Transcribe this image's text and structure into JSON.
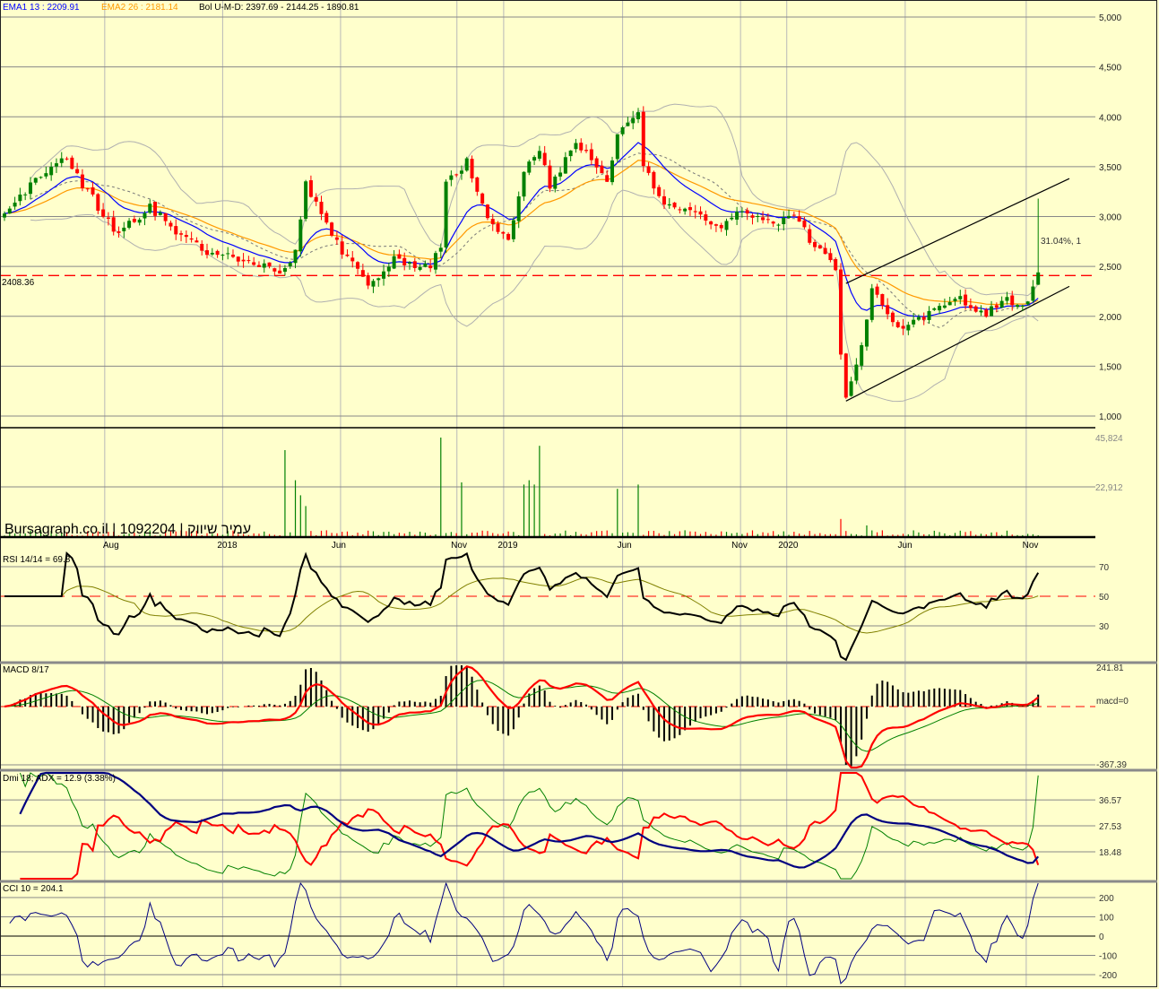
{
  "header": {
    "ema1_label": "EMA1 13 : 2209.91",
    "ema2_label": "EMA2 26 : 2181.14",
    "bollinger_label": "Bol U-M-D: 2397.69 - 2144.25 - 1890.81",
    "ref_line_label": "2408.36",
    "annotation": "31.04%, 1",
    "watermark": "Bursagraph.co.il | 1092204 | עמיר שיווק"
  },
  "panels": {
    "rsi_label": "RSI 14/14 = 69.8",
    "macd_label": "MACD 8/17",
    "macd_zero_label": "macd=0",
    "dmi_label": "Dmi 18; ADX = 12.9 (3.38%)",
    "cci_label": "CCI 10 = 204.1"
  },
  "colors": {
    "background": "#FFFFCC",
    "up": "#008000",
    "down": "#FF0000",
    "ema1": "#0000FF",
    "ema2": "#FF9900",
    "bollinger": "#B0B0B0",
    "grid": "#888888",
    "vgrid": "#B8B8B8"
  },
  "chart_data": {
    "type": "candlestick",
    "candles": 200,
    "price_path": [
      [
        0,
        2987
      ],
      [
        6,
        3373
      ],
      [
        11,
        3625
      ],
      [
        15,
        3328
      ],
      [
        21,
        2879
      ],
      [
        23,
        2879
      ],
      [
        28,
        3100
      ],
      [
        34,
        2789
      ],
      [
        41,
        2609
      ],
      [
        47,
        2564
      ],
      [
        54,
        2450
      ],
      [
        56,
        2700
      ],
      [
        58,
        3328
      ],
      [
        61,
        3013
      ],
      [
        65,
        2654
      ],
      [
        70,
        2294
      ],
      [
        75,
        2564
      ],
      [
        82,
        2500
      ],
      [
        84,
        2700
      ],
      [
        85,
        3328
      ],
      [
        89,
        3553
      ],
      [
        93,
        2969
      ],
      [
        97,
        2744
      ],
      [
        100,
        3418
      ],
      [
        103,
        3688
      ],
      [
        105,
        3283
      ],
      [
        110,
        3733
      ],
      [
        114,
        3508
      ],
      [
        116,
        3328
      ],
      [
        118,
        3823
      ],
      [
        122,
        4002
      ],
      [
        123,
        3500
      ],
      [
        127,
        3103
      ],
      [
        132,
        3100
      ],
      [
        137,
        2879
      ],
      [
        142,
        3058
      ],
      [
        148,
        2924
      ],
      [
        152,
        3013
      ],
      [
        156,
        2699
      ],
      [
        160,
        2474
      ],
      [
        161,
        1575
      ],
      [
        162,
        1216
      ],
      [
        165,
        1710
      ],
      [
        167,
        2249
      ],
      [
        170,
        2024
      ],
      [
        173,
        1890
      ],
      [
        179,
        2069
      ],
      [
        184,
        2159
      ],
      [
        189,
        2024
      ],
      [
        193,
        2159
      ],
      [
        196,
        2069
      ],
      [
        198,
        2294
      ],
      [
        199,
        2440
      ]
    ],
    "last_high": 3180,
    "ref_level": 2408.36,
    "trendlines": [
      [
        [
          162,
          1150
        ],
        [
          205,
          2300
        ]
      ],
      [
        [
          162,
          2330
        ],
        [
          205,
          3380
        ]
      ]
    ],
    "price_axis": {
      "ticks": [
        "1,000",
        "1,500",
        "2,000",
        "2,500",
        "3,000",
        "3,500",
        "4,000",
        "4,500",
        "5,000"
      ],
      "values": [
        1000,
        1500,
        2000,
        2500,
        3000,
        3500,
        4000,
        4500,
        5000
      ]
    },
    "volume_axis": {
      "ticks": [
        "45,824",
        "22,912"
      ],
      "values": [
        45824,
        22912
      ]
    },
    "volume_spikes": [
      [
        54,
        40000
      ],
      [
        56,
        26000
      ],
      [
        57,
        19000
      ],
      [
        58,
        14000
      ],
      [
        84,
        45824
      ],
      [
        88,
        25000
      ],
      [
        100,
        24000
      ],
      [
        101,
        26000
      ],
      [
        102,
        24000
      ],
      [
        103,
        42000
      ],
      [
        118,
        22000
      ],
      [
        122,
        24000
      ],
      [
        161,
        8000
      ],
      [
        166,
        5000
      ]
    ],
    "x_labels": [
      {
        "week": 20,
        "label": "Aug"
      },
      {
        "week": 42,
        "label": "2018"
      },
      {
        "week": 64,
        "label": "Jun"
      },
      {
        "week": 87,
        "label": "Nov"
      },
      {
        "week": 96,
        "label": "2019"
      },
      {
        "week": 119,
        "label": "Jun"
      },
      {
        "week": 141,
        "label": "Nov"
      },
      {
        "week": 150,
        "label": "2020"
      },
      {
        "week": 173,
        "label": "Jun"
      },
      {
        "week": 197,
        "label": "Nov"
      }
    ],
    "vgrid_weeks": [
      19.3,
      42,
      64.7,
      87.1,
      96.1,
      119,
      141.7,
      150.6,
      173.4,
      196.7
    ],
    "rsi_axis": {
      "ticks": [
        "70",
        "50",
        "30"
      ],
      "values": [
        70,
        50,
        30
      ]
    },
    "macd_axis": {
      "max": "241.81",
      "min": "-367.39",
      "max_value": 241.81,
      "min_value": -367.39
    },
    "dmi_axis": {
      "ticks": [
        "36.57",
        "27.53",
        "18.48"
      ],
      "values": [
        36.57,
        27.53,
        18.48
      ]
    },
    "cci_axis": {
      "ticks": [
        "200",
        "100",
        "0",
        "-100",
        "-200"
      ],
      "values": [
        200,
        100,
        0,
        -100,
        -200
      ]
    }
  }
}
